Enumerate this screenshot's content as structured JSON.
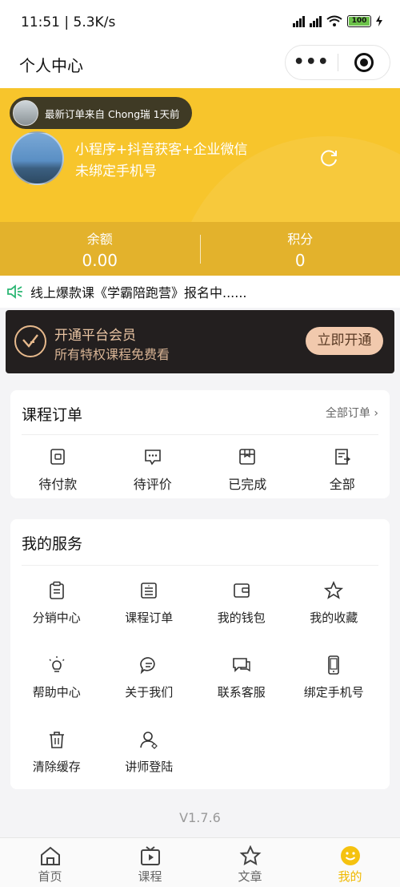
{
  "status_bar": {
    "time": "11:51 | 5.3K/s",
    "battery": "100"
  },
  "nav": {
    "title": "个人中心",
    "more_label": "•••"
  },
  "hero": {
    "notice": "最新订单来自 Chong瑞 1天前",
    "name": "小程序+抖音获客+企业微信",
    "phone_status": "未绑定手机号",
    "balance_label": "余额",
    "balance_value": "0.00",
    "points_label": "积分",
    "points_value": "0"
  },
  "marquee": {
    "text": "线上爆款课《学霸陪跑营》报名中......"
  },
  "vip": {
    "title": "开通平台会员",
    "subtitle": "所有特权课程免费看",
    "button": "立即开通"
  },
  "orders": {
    "title": "课程订单",
    "all_link": "全部订单 ›",
    "items": [
      {
        "label": "待付款",
        "icon": "wallet-icon"
      },
      {
        "label": "待评价",
        "icon": "comment-icon"
      },
      {
        "label": "已完成",
        "icon": "box-icon"
      },
      {
        "label": "全部",
        "icon": "document-icon"
      }
    ]
  },
  "services": {
    "title": "我的服务",
    "items": [
      {
        "label": "分销中心",
        "icon": "clipboard-icon"
      },
      {
        "label": "课程订单",
        "icon": "list-icon"
      },
      {
        "label": "我的钱包",
        "icon": "wallet-icon"
      },
      {
        "label": "我的收藏",
        "icon": "star-icon"
      },
      {
        "label": "帮助中心",
        "icon": "lightbulb-icon"
      },
      {
        "label": "关于我们",
        "icon": "chat-icon"
      },
      {
        "label": "联系客服",
        "icon": "support-chat-icon"
      },
      {
        "label": "绑定手机号",
        "icon": "phone-icon"
      },
      {
        "label": "清除缓存",
        "icon": "trash-icon"
      },
      {
        "label": "讲师登陆",
        "icon": "user-icon"
      }
    ]
  },
  "version": "V1.7.6",
  "tabs": [
    {
      "label": "首页",
      "icon": "home-icon"
    },
    {
      "label": "课程",
      "icon": "play-icon"
    },
    {
      "label": "文章",
      "icon": "star-icon"
    },
    {
      "label": "我的",
      "icon": "smile-icon",
      "active": true
    }
  ],
  "colors": {
    "brand_yellow": "#f7c52c",
    "tab_active": "#f0b900",
    "vip_gold": "#e8c3a2"
  }
}
